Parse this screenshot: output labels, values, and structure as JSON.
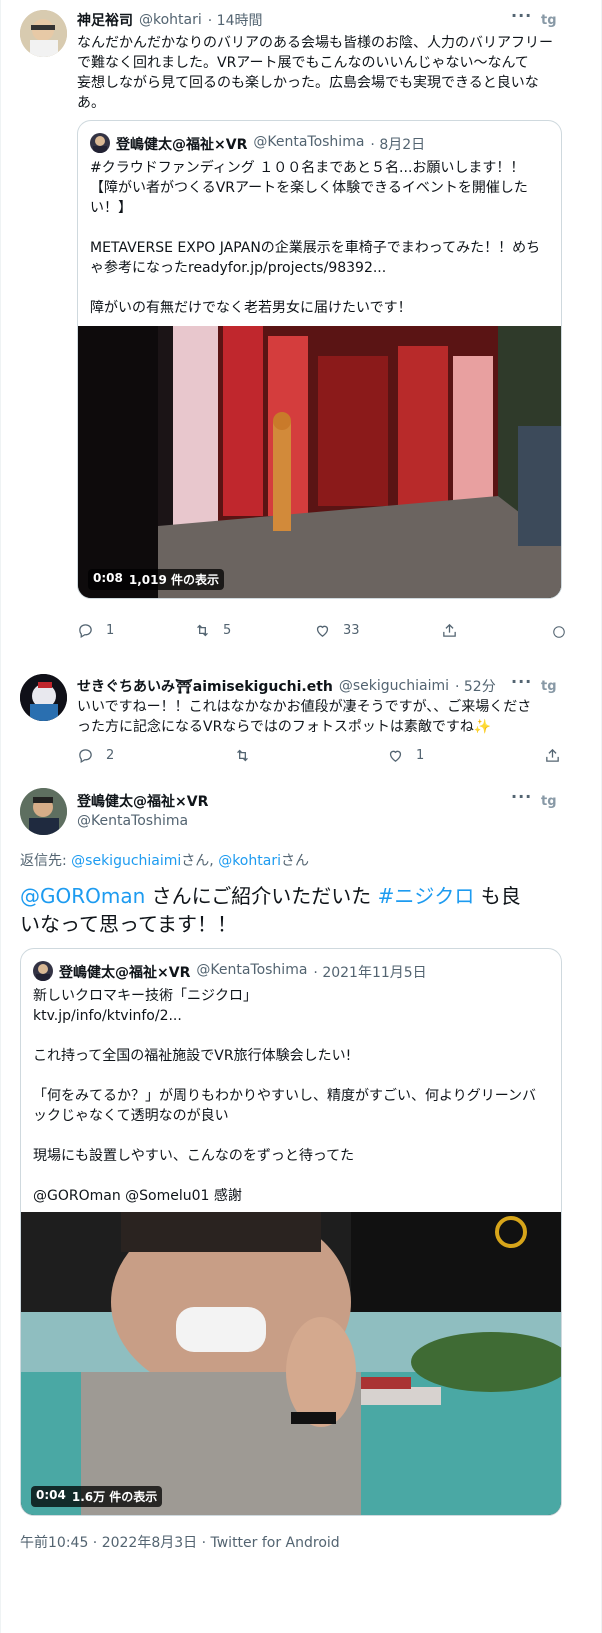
{
  "tweet1": {
    "name": "神足裕司",
    "handle": "@kohtari",
    "time": "· 14時間",
    "text_lines": [
      "なんだかんだかなりのバリアのある会場も皆様のお陰、人力のバリアフリー",
      "で難なく回れました。VRアート展でもこんなのいいんじゃない〜なんて",
      "妄想しながら見て回るのも楽しかった。広島会場でも実現できると良いな",
      "あ。"
    ],
    "quote": {
      "name": "登嶋健太@福祉×VR",
      "handle": "@KentaToshima",
      "date": "· 8月2日",
      "lines": [
        "#クラウドファンディング １００名まであと５名...お願いします！！",
        "【障がい者がつくるVRアートを楽しく体験できるイベントを開催した",
        "い！】",
        "",
        "METAVERSE EXPO JAPANの企業展示を車椅子でまわってみた！！めち",
        "ゃ参考になったreadyfor.jp/projects/98392...",
        "",
        "障がいの有無だけでなく老若男女に届けたいです！"
      ],
      "video_duration": "0:08",
      "video_views": "1,019 件の表示"
    },
    "replies": "1",
    "retweets": "5",
    "likes": "33"
  },
  "tweet2": {
    "name": "せきぐちあいみ⛩aimisekiguchi.eth",
    "handle": "@sekiguchiaimi",
    "time": "· 52分",
    "text_lines": [
      "いいですねー！！これはなかなかお値段が凄そうですが、、ご来場くださ",
      "った方に記念になるVRならではのフォトスポットは素敵ですね✨"
    ],
    "replies": "2",
    "retweets": "",
    "likes": "1"
  },
  "tweet3": {
    "name": "登嶋健太@福祉×VR",
    "handle": "@KentaToshima",
    "reply_prefix": "返信先: ",
    "reply_to_1": "@sekiguchiaimi",
    "reply_sep": "さん, ",
    "reply_to_2": "@kohtari",
    "reply_suffix": "さん",
    "main_mention": "@GOROman",
    "main_mid": " さんにご紹介いただいた ",
    "main_hashtag": "#ニジクロ",
    "main_end": " も良",
    "main_line2": "いなって思ってます！！",
    "quote": {
      "name": "登嶋健太@福祉×VR",
      "handle": "@KentaToshima",
      "date": "· 2021年11月5日",
      "lines": [
        "新しいクロマキー技術「ニジクロ」",
        "ktv.jp/info/ktvinfo/2...",
        "",
        "これ持って全国の福祉施設でVR旅行体験会したい!",
        "",
        "「何をみてるか？」が周りもわかりやすいし、精度がすごい、何よりグリーンバ",
        "ックじゃなくて透明なのが良い",
        "",
        "現場にも設置しやすい、こんなのをずっと待ってた",
        "",
        "@GOROman @Somelu01  感謝"
      ],
      "video_duration": "0:04",
      "video_views": "1.6万 件の表示"
    },
    "footer": "午前10:45 · 2022年8月3日 · Twitter for Android"
  },
  "colors": {
    "link": "#1d9bf0",
    "secondary": "#536471",
    "border": "#cfd9de"
  }
}
